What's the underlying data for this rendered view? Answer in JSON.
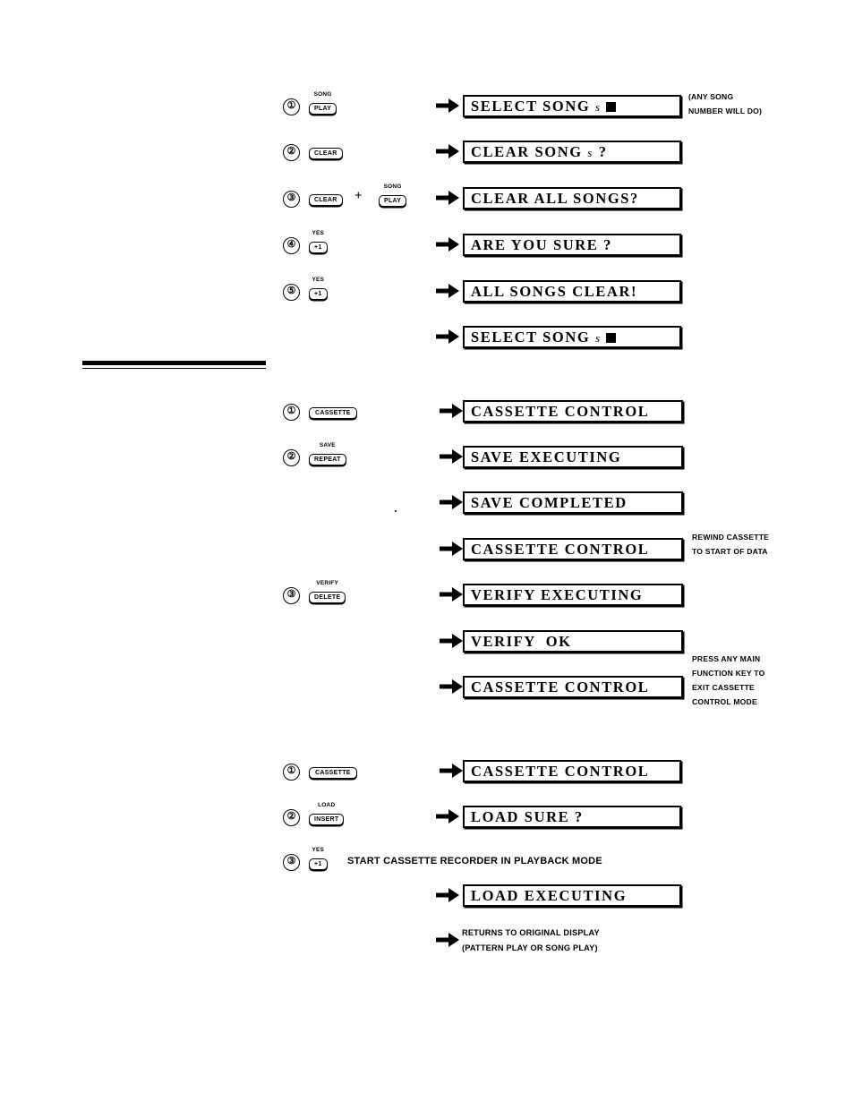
{
  "document": {
    "type": "drum-machine-operation-flow-diagram",
    "background": "#ffffff",
    "ink": "#000000"
  },
  "divider": {
    "name": "section-rule"
  },
  "sections": [
    {
      "id": "clear-song",
      "rows": [
        {
          "step": "①",
          "key": {
            "top": "SONG",
            "cap": "PLAY"
          },
          "display": "SELECT SONG s ■",
          "display_parts": {
            "prefix": "SELECT SONG ",
            "italic": "s",
            "suffix": " ",
            "cursor": true
          },
          "note": [
            "(ANY SONG",
            "NUMBER WILL DO)"
          ]
        },
        {
          "step": "②",
          "key": {
            "top": "",
            "cap": "CLEAR"
          },
          "display": "CLEAR SONG s ?",
          "display_parts": {
            "prefix": "CLEAR SONG ",
            "italic": "s",
            "suffix": " ?",
            "cursor": false
          },
          "note": []
        },
        {
          "step": "③",
          "key": {
            "top": "",
            "cap": "CLEAR"
          },
          "plus": "+",
          "key2": {
            "top": "SONG",
            "cap": "PLAY"
          },
          "display": "CLEAR ALL SONGS?",
          "display_parts": {
            "prefix": "CLEAR ALL SONGS?",
            "italic": "",
            "suffix": "",
            "cursor": false
          },
          "note": []
        },
        {
          "step": "④",
          "key": {
            "top": "YES",
            "cap": "+1"
          },
          "display": "ARE YOU SURE ?",
          "display_parts": {
            "prefix": "ARE YOU SURE ?",
            "italic": "",
            "suffix": "",
            "cursor": false
          },
          "note": []
        },
        {
          "step": "⑤",
          "key": {
            "top": "YES",
            "cap": "+1"
          },
          "display": "ALL SONGS CLEAR!",
          "display_parts": {
            "prefix": "ALL SONGS CLEAR!",
            "italic": "",
            "suffix": "",
            "cursor": false
          },
          "note": []
        },
        {
          "step": "",
          "key": null,
          "display": "SELECT SONG s ■",
          "display_parts": {
            "prefix": "SELECT SONG ",
            "italic": "s",
            "suffix": " ",
            "cursor": true
          },
          "note": []
        }
      ]
    },
    {
      "id": "save-verify",
      "rows": [
        {
          "step": "①",
          "key": {
            "top": "",
            "cap": "CASSETTE"
          },
          "display": "CASSETTE CONTROL",
          "display_parts": {
            "prefix": "CASSETTE CONTROL",
            "italic": "",
            "suffix": "",
            "cursor": false
          },
          "note": []
        },
        {
          "step": "②",
          "key": {
            "top": "SAVE",
            "cap": "REPEAT"
          },
          "display": "SAVE EXECUTING",
          "display_parts": {
            "prefix": "SAVE EXECUTING",
            "italic": "",
            "suffix": "",
            "cursor": false
          },
          "note": []
        },
        {
          "step": "",
          "key": null,
          "display": "SAVE COMPLETED",
          "display_parts": {
            "prefix": "SAVE COMPLETED",
            "italic": "",
            "suffix": "",
            "cursor": false
          },
          "note": []
        },
        {
          "step": "",
          "key": null,
          "display": "CASSETTE CONTROL",
          "display_parts": {
            "prefix": "CASSETTE CONTROL",
            "italic": "",
            "suffix": "",
            "cursor": false
          },
          "note": [
            "REWIND CASSETTE",
            "TO START OF DATA"
          ]
        },
        {
          "step": "③",
          "key": {
            "top": "VERIFY",
            "cap": "DELETE"
          },
          "display": "VERIFY EXECUTING",
          "display_parts": {
            "prefix": "VERIFY EXECUTING",
            "italic": "",
            "suffix": "",
            "cursor": false
          },
          "note": []
        },
        {
          "step": "",
          "key": null,
          "display": "VERIFY  OK",
          "display_parts": {
            "prefix": "VERIFY  OK",
            "italic": "",
            "suffix": "",
            "cursor": false
          },
          "note": []
        },
        {
          "step": "",
          "key": null,
          "display": "CASSETTE CONTROL",
          "display_parts": {
            "prefix": "CASSETTE CONTROL",
            "italic": "",
            "suffix": "",
            "cursor": false
          },
          "note": [
            "PRESS ANY MAIN",
            "FUNCTION KEY TO",
            "EXIT CASSETTE",
            "CONTROL MODE"
          ]
        }
      ]
    },
    {
      "id": "load",
      "rows": [
        {
          "step": "①",
          "key": {
            "top": "",
            "cap": "CASSETTE"
          },
          "display": "CASSETTE CONTROL",
          "display_parts": {
            "prefix": "CASSETTE CONTROL",
            "italic": "",
            "suffix": "",
            "cursor": false
          },
          "note": []
        },
        {
          "step": "②",
          "key": {
            "top": "LOAD",
            "cap": "INSERT"
          },
          "display": "LOAD SURE ?",
          "display_parts": {
            "prefix": "LOAD SURE ?",
            "italic": "",
            "suffix": "",
            "cursor": false
          },
          "note": []
        },
        {
          "step": "③",
          "key": {
            "top": "YES",
            "cap": "+1"
          },
          "inline_note": "START CASSETTE RECORDER IN PLAYBACK MODE",
          "display": null,
          "note": []
        },
        {
          "step": "",
          "key": null,
          "display": "LOAD EXECUTING",
          "display_parts": {
            "prefix": "LOAD EXECUTING",
            "italic": "",
            "suffix": "",
            "cursor": false
          },
          "note": []
        },
        {
          "step": "",
          "key": null,
          "display": null,
          "tail_note": [
            "RETURNS TO ORIGINAL DISPLAY",
            "(PATTERN PLAY OR SONG PLAY)"
          ],
          "note": []
        }
      ]
    }
  ],
  "labels": {
    "s1r1_note1": "(ANY SONG",
    "s1r1_note2": "NUMBER WILL DO)",
    "s2r4_note1": "REWIND CASSETTE",
    "s2r4_note2": "TO START OF DATA",
    "s2r7_note1": "PRESS ANY MAIN",
    "s2r7_note2": "FUNCTION KEY TO",
    "s2r7_note3": "EXIT CASSETTE",
    "s2r7_note4": "CONTROL MODE",
    "s3r3_inline": "START CASSETTE RECORDER IN PLAYBACK MODE",
    "s3r5_tail1": "RETURNS TO ORIGINAL DISPLAY",
    "s3r5_tail2": "(PATTERN PLAY OR SONG PLAY)"
  }
}
